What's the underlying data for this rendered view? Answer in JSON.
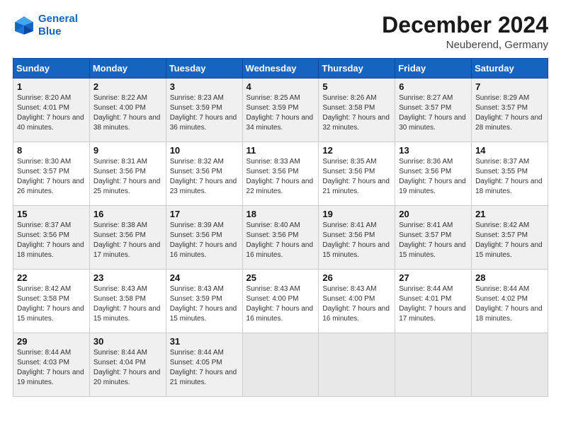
{
  "header": {
    "logo_line1": "General",
    "logo_line2": "Blue",
    "month_title": "December 2024",
    "location": "Neuberend, Germany"
  },
  "weekdays": [
    "Sunday",
    "Monday",
    "Tuesday",
    "Wednesday",
    "Thursday",
    "Friday",
    "Saturday"
  ],
  "rows": [
    [
      {
        "day": "1",
        "info": "Sunrise: 8:20 AM\nSunset: 4:01 PM\nDaylight: 7 hours\nand 40 minutes."
      },
      {
        "day": "2",
        "info": "Sunrise: 8:22 AM\nSunset: 4:00 PM\nDaylight: 7 hours\nand 38 minutes."
      },
      {
        "day": "3",
        "info": "Sunrise: 8:23 AM\nSunset: 3:59 PM\nDaylight: 7 hours\nand 36 minutes."
      },
      {
        "day": "4",
        "info": "Sunrise: 8:25 AM\nSunset: 3:59 PM\nDaylight: 7 hours\nand 34 minutes."
      },
      {
        "day": "5",
        "info": "Sunrise: 8:26 AM\nSunset: 3:58 PM\nDaylight: 7 hours\nand 32 minutes."
      },
      {
        "day": "6",
        "info": "Sunrise: 8:27 AM\nSunset: 3:57 PM\nDaylight: 7 hours\nand 30 minutes."
      },
      {
        "day": "7",
        "info": "Sunrise: 8:29 AM\nSunset: 3:57 PM\nDaylight: 7 hours\nand 28 minutes."
      }
    ],
    [
      {
        "day": "8",
        "info": "Sunrise: 8:30 AM\nSunset: 3:57 PM\nDaylight: 7 hours\nand 26 minutes."
      },
      {
        "day": "9",
        "info": "Sunrise: 8:31 AM\nSunset: 3:56 PM\nDaylight: 7 hours\nand 25 minutes."
      },
      {
        "day": "10",
        "info": "Sunrise: 8:32 AM\nSunset: 3:56 PM\nDaylight: 7 hours\nand 23 minutes."
      },
      {
        "day": "11",
        "info": "Sunrise: 8:33 AM\nSunset: 3:56 PM\nDaylight: 7 hours\nand 22 minutes."
      },
      {
        "day": "12",
        "info": "Sunrise: 8:35 AM\nSunset: 3:56 PM\nDaylight: 7 hours\nand 21 minutes."
      },
      {
        "day": "13",
        "info": "Sunrise: 8:36 AM\nSunset: 3:56 PM\nDaylight: 7 hours\nand 19 minutes."
      },
      {
        "day": "14",
        "info": "Sunrise: 8:37 AM\nSunset: 3:55 PM\nDaylight: 7 hours\nand 18 minutes."
      }
    ],
    [
      {
        "day": "15",
        "info": "Sunrise: 8:37 AM\nSunset: 3:56 PM\nDaylight: 7 hours\nand 18 minutes."
      },
      {
        "day": "16",
        "info": "Sunrise: 8:38 AM\nSunset: 3:56 PM\nDaylight: 7 hours\nand 17 minutes."
      },
      {
        "day": "17",
        "info": "Sunrise: 8:39 AM\nSunset: 3:56 PM\nDaylight: 7 hours\nand 16 minutes."
      },
      {
        "day": "18",
        "info": "Sunrise: 8:40 AM\nSunset: 3:56 PM\nDaylight: 7 hours\nand 16 minutes."
      },
      {
        "day": "19",
        "info": "Sunrise: 8:41 AM\nSunset: 3:56 PM\nDaylight: 7 hours\nand 15 minutes."
      },
      {
        "day": "20",
        "info": "Sunrise: 8:41 AM\nSunset: 3:57 PM\nDaylight: 7 hours\nand 15 minutes."
      },
      {
        "day": "21",
        "info": "Sunrise: 8:42 AM\nSunset: 3:57 PM\nDaylight: 7 hours\nand 15 minutes."
      }
    ],
    [
      {
        "day": "22",
        "info": "Sunrise: 8:42 AM\nSunset: 3:58 PM\nDaylight: 7 hours\nand 15 minutes."
      },
      {
        "day": "23",
        "info": "Sunrise: 8:43 AM\nSunset: 3:58 PM\nDaylight: 7 hours\nand 15 minutes."
      },
      {
        "day": "24",
        "info": "Sunrise: 8:43 AM\nSunset: 3:59 PM\nDaylight: 7 hours\nand 15 minutes."
      },
      {
        "day": "25",
        "info": "Sunrise: 8:43 AM\nSunset: 4:00 PM\nDaylight: 7 hours\nand 16 minutes."
      },
      {
        "day": "26",
        "info": "Sunrise: 8:43 AM\nSunset: 4:00 PM\nDaylight: 7 hours\nand 16 minutes."
      },
      {
        "day": "27",
        "info": "Sunrise: 8:44 AM\nSunset: 4:01 PM\nDaylight: 7 hours\nand 17 minutes."
      },
      {
        "day": "28",
        "info": "Sunrise: 8:44 AM\nSunset: 4:02 PM\nDaylight: 7 hours\nand 18 minutes."
      }
    ],
    [
      {
        "day": "29",
        "info": "Sunrise: 8:44 AM\nSunset: 4:03 PM\nDaylight: 7 hours\nand 19 minutes."
      },
      {
        "day": "30",
        "info": "Sunrise: 8:44 AM\nSunset: 4:04 PM\nDaylight: 7 hours\nand 20 minutes."
      },
      {
        "day": "31",
        "info": "Sunrise: 8:44 AM\nSunset: 4:05 PM\nDaylight: 7 hours\nand 21 minutes."
      },
      null,
      null,
      null,
      null
    ]
  ]
}
